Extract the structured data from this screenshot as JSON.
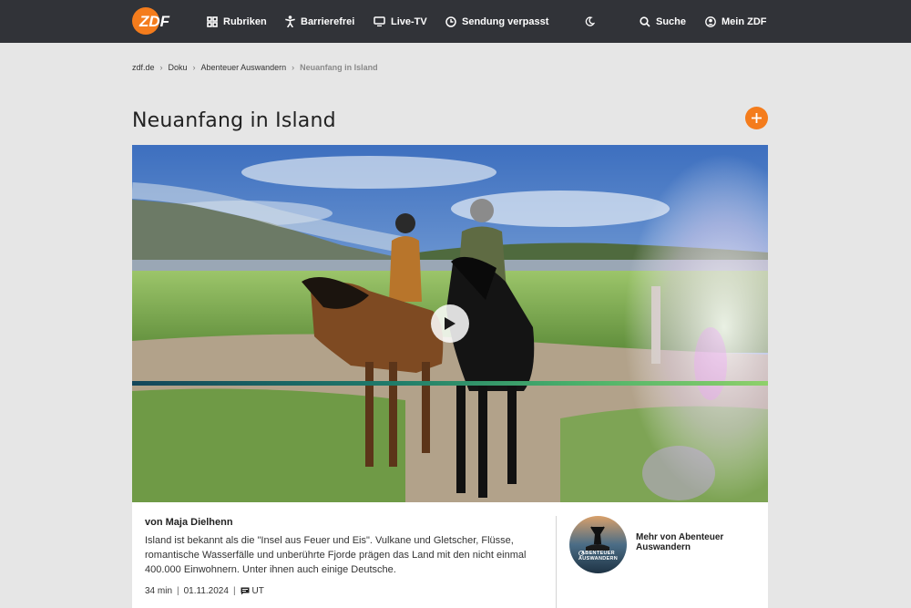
{
  "nav": {
    "logo": "ZDF",
    "items": [
      {
        "label": "Rubriken",
        "icon": "grid-icon"
      },
      {
        "label": "Barrierefrei",
        "icon": "accessibility-icon"
      },
      {
        "label": "Live-TV",
        "icon": "tv-icon"
      },
      {
        "label": "Sendung verpasst",
        "icon": "clock-icon"
      }
    ],
    "theme_icon": "moon-icon",
    "search_label": "Suche",
    "account_label": "Mein ZDF"
  },
  "breadcrumb": [
    "zdf.de",
    "Doku",
    "Abenteuer Auswandern",
    "Neuanfang in Island"
  ],
  "page_title": "Neuanfang in Island",
  "accent_color": "#f47c1c",
  "video": {
    "play_icon": "play-icon",
    "progress_fraction": 1.0
  },
  "info": {
    "author": "von Maja Dielhenn",
    "description": "Island ist bekannt als die \"Insel aus Feuer und Eis\". Vulkane und Gletscher, Flüsse, romantische Wasserfälle und unberührte Fjorde prägen das Land mit den nicht einmal 400.000 Einwohnern. Unter ihnen auch einige Deutsche.",
    "duration": "34 min",
    "date": "01.11.2024",
    "subtitles": "UT",
    "series_logo_text": "ABENTEUER AUSWANDERN",
    "more_link": "Mehr von Abenteuer Auswandern"
  }
}
